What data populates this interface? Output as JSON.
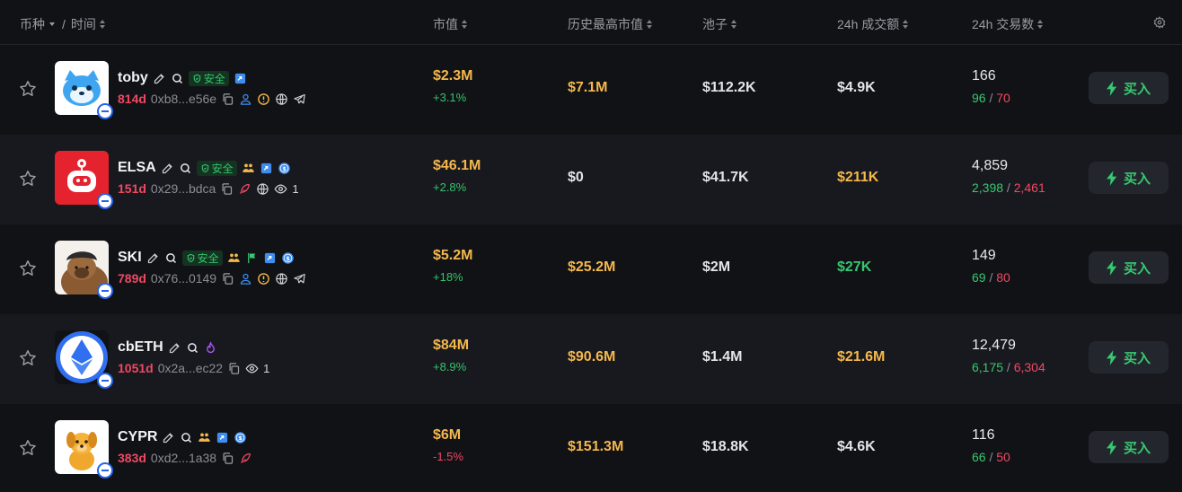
{
  "header": {
    "coin_label": "币种",
    "sep": "/",
    "time_label": "时间",
    "mcap_label": "市值",
    "ath_label": "历史最高市值",
    "pool_label": "池子",
    "vol_label": "24h 成交额",
    "txcount_label": "24h 交易数"
  },
  "colors": {
    "gold": "#f5b84b",
    "green": "#37c871",
    "red": "#f04863",
    "bg": "#111216"
  },
  "tokens": [
    {
      "name": "toby",
      "safe": "安全",
      "age": "814d",
      "address": "0xb8...e56e",
      "mcap": "$2.3M",
      "change": "+3.1%",
      "ath": "$7.1M",
      "pool": "$112.2K",
      "volume": "$4.9K",
      "tx_total": "166",
      "tx_buy": "96",
      "tx_sell": "70",
      "buy_label": "买入",
      "views": ""
    },
    {
      "name": "ELSA",
      "safe": "安全",
      "age": "151d",
      "address": "0x29...bdca",
      "mcap": "$46.1M",
      "change": "+2.8%",
      "ath": "$0",
      "pool": "$41.7K",
      "volume": "$211K",
      "tx_total": "4,859",
      "tx_buy": "2,398",
      "tx_sell": "2,461",
      "buy_label": "买入",
      "views": "1"
    },
    {
      "name": "SKI",
      "safe": "安全",
      "age": "789d",
      "address": "0x76...0149",
      "mcap": "$5.2M",
      "change": "+18%",
      "ath": "$25.2M",
      "pool": "$2M",
      "volume": "$27K",
      "tx_total": "149",
      "tx_buy": "69",
      "tx_sell": "80",
      "buy_label": "买入",
      "views": ""
    },
    {
      "name": "cbETH",
      "safe": "",
      "age": "1051d",
      "address": "0x2a...ec22",
      "mcap": "$84M",
      "change": "+8.9%",
      "ath": "$90.6M",
      "pool": "$1.4M",
      "volume": "$21.6M",
      "tx_total": "12,479",
      "tx_buy": "6,175",
      "tx_sell": "6,304",
      "buy_label": "买入",
      "views": "1"
    },
    {
      "name": "CYPR",
      "safe": "",
      "age": "383d",
      "address": "0xd2...1a38",
      "mcap": "$6M",
      "change": "-1.5%",
      "ath": "$151.3M",
      "pool": "$18.8K",
      "volume": "$4.6K",
      "tx_total": "116",
      "tx_buy": "66",
      "tx_sell": "50",
      "buy_label": "买入",
      "views": ""
    }
  ],
  "icons": [
    "star-icon",
    "edit-icon",
    "search-icon",
    "shield-icon",
    "twitter-verified-icon",
    "copy-icon",
    "user-icon",
    "warning-icon",
    "globe-icon",
    "telegram-icon",
    "holders-icon",
    "dollar-coin-icon",
    "feather-icon",
    "eye-icon",
    "flame-icon",
    "lightning-icon",
    "gear-icon"
  ]
}
